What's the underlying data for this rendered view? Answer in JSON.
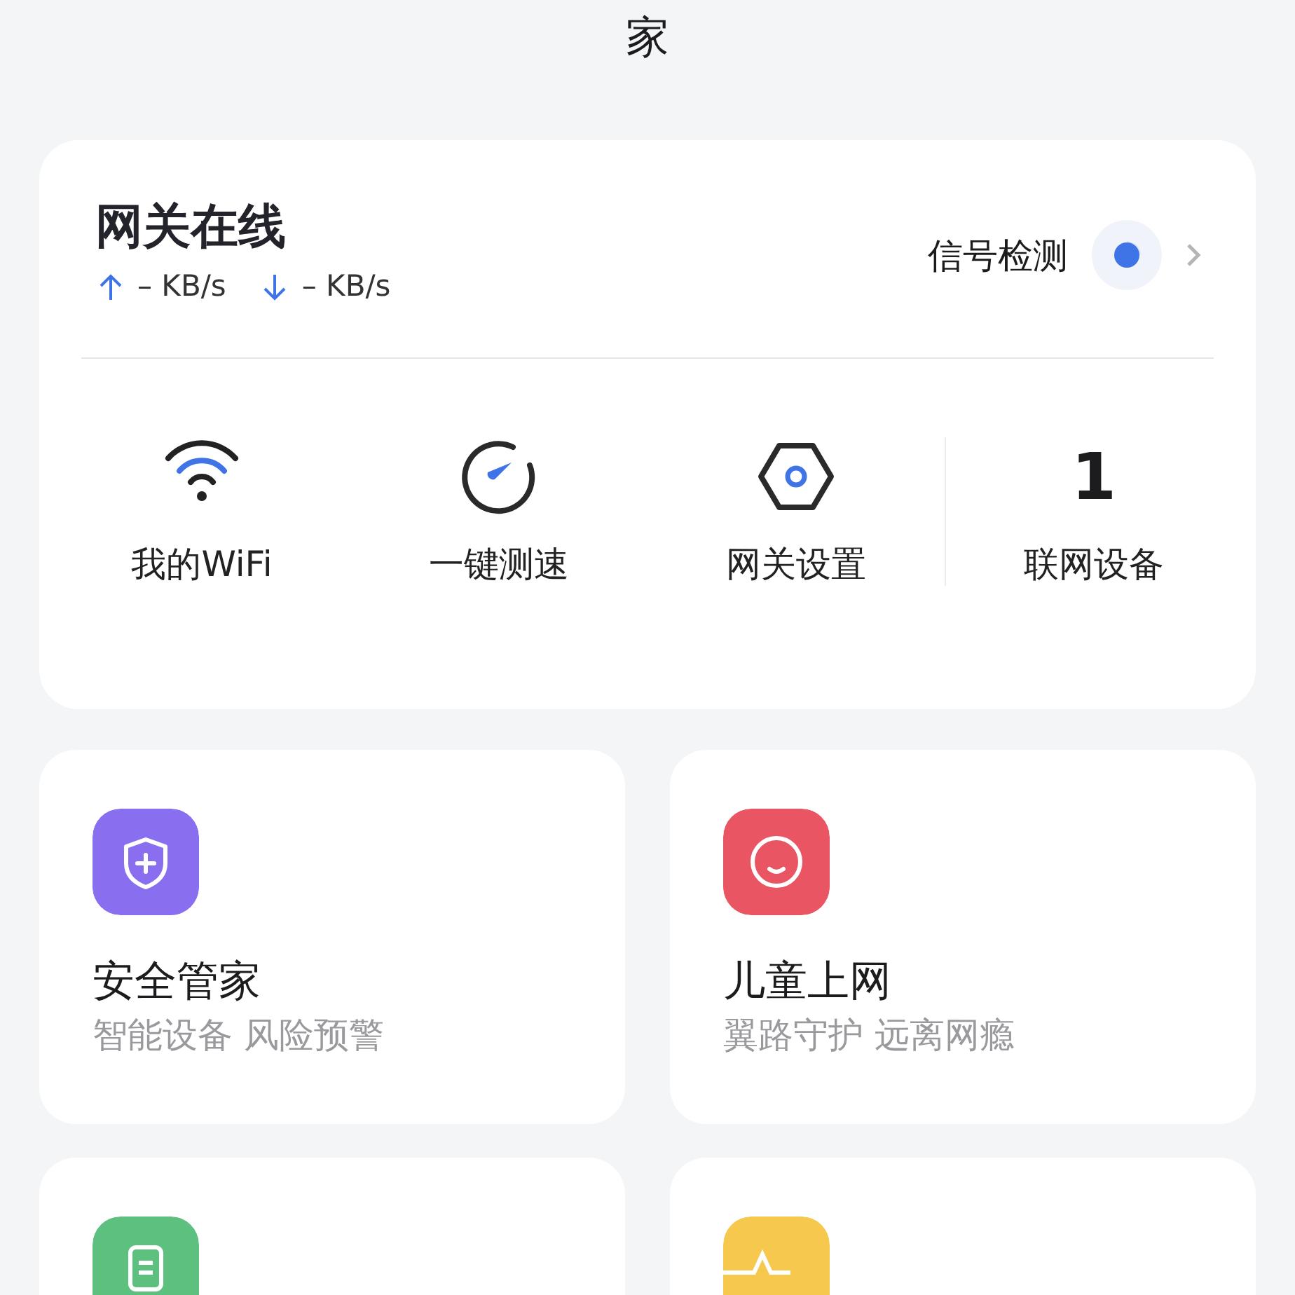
{
  "page_title": "家",
  "gateway": {
    "status": "网关在线",
    "upload": "– KB/s",
    "download": "– KB/s",
    "signal_label": "信号检测"
  },
  "actions": [
    {
      "kind": "wifi",
      "label": "我的WiFi"
    },
    {
      "kind": "speed",
      "label": "一键测速"
    },
    {
      "kind": "settings",
      "label": "网关设置"
    },
    {
      "kind": "count",
      "value": "1",
      "label": "联网设备"
    }
  ],
  "tiles": [
    {
      "kind": "shield",
      "color": "#8a6ef0",
      "title": "安全管家",
      "subtitle": "智能设备 风险预警"
    },
    {
      "kind": "face",
      "color": "#ea5563",
      "title": "儿童上网",
      "subtitle": "翼路守护 远离网瘾"
    },
    {
      "kind": "document",
      "color": "#5ec07f"
    },
    {
      "kind": "pulse",
      "color": "#f6c94e"
    }
  ]
}
